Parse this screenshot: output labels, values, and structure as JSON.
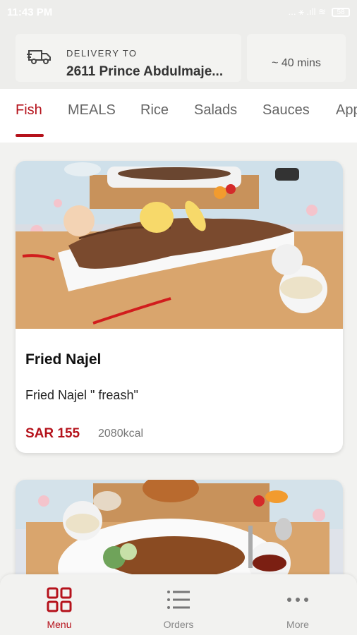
{
  "status_bar": {
    "time": "11:43 PM",
    "icons": "... ⚹ .ıll ≋",
    "battery": "58"
  },
  "header": {
    "delivery_label": "DELIVERY TO",
    "delivery_address": "2611 Prince Abdulmaje...",
    "eta": "~ 40 mins",
    "icon": "truck-icon"
  },
  "tabs": [
    {
      "label": "Fish",
      "active": true
    },
    {
      "label": "MEALS"
    },
    {
      "label": "Rice"
    },
    {
      "label": "Salads"
    },
    {
      "label": "Sauces"
    },
    {
      "label": "App"
    }
  ],
  "menu_items": [
    {
      "name": "Fried Najel",
      "description": "Fried Najel \" freash\"",
      "price": "SAR 155",
      "kcal": "2080kcal"
    }
  ],
  "colors": {
    "accent": "#b5121b",
    "background": "#f2f2f0",
    "header": "#ededeb"
  },
  "bottom_nav": [
    {
      "label": "Menu",
      "icon": "grid-icon",
      "active": true
    },
    {
      "label": "Orders",
      "icon": "list-icon"
    },
    {
      "label": "More",
      "icon": "dots-icon"
    }
  ]
}
